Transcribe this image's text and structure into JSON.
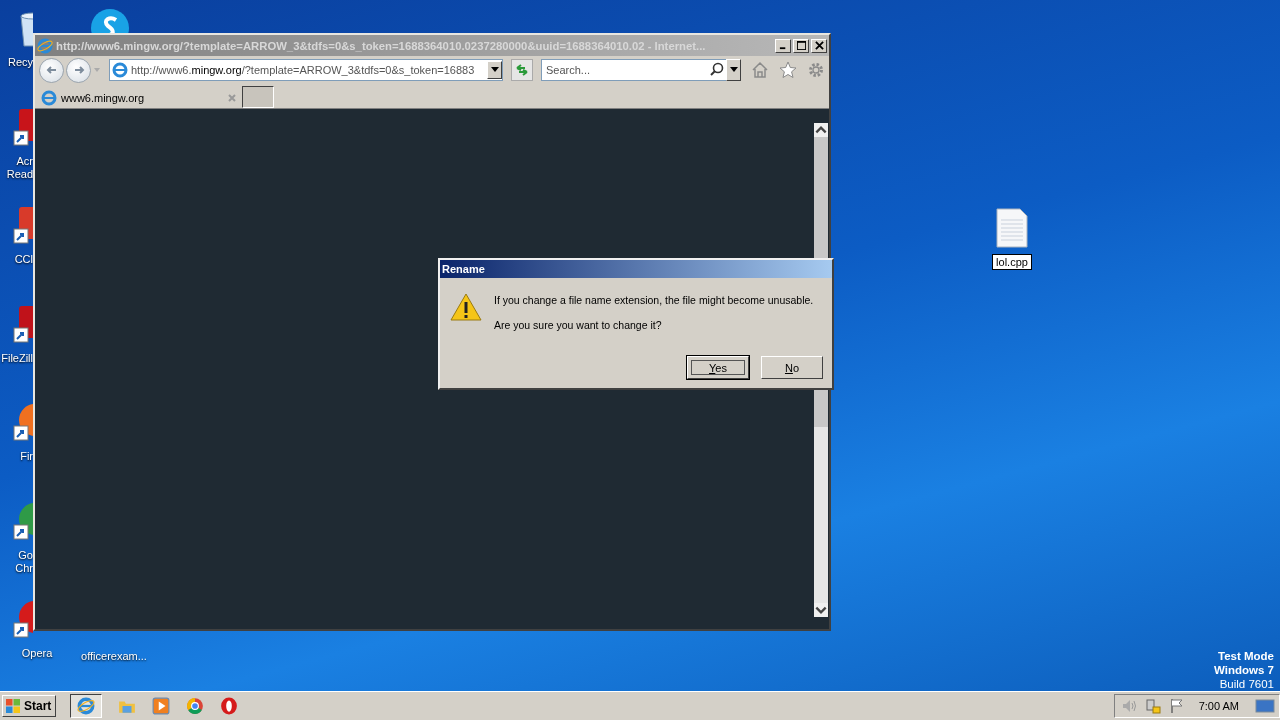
{
  "desktop_icons": [
    {
      "kind": "recycle",
      "lines": [
        "Recy"
      ]
    },
    {
      "kind": "acrobat",
      "lines": [
        "Acr",
        "Read"
      ]
    },
    {
      "kind": "ccleaner",
      "lines": [
        "CCl"
      ]
    },
    {
      "kind": "filezilla",
      "lines": [
        "FileZill"
      ]
    },
    {
      "kind": "firefox",
      "lines": [
        "Fir"
      ]
    },
    {
      "kind": "chrome",
      "lines": [
        "Go",
        "Chr"
      ]
    },
    {
      "kind": "opera",
      "lines": [
        "Opera"
      ]
    }
  ],
  "second_column": [
    {
      "kind": "skype"
    },
    {
      "kind": "document",
      "lines": [
        "officerexam..."
      ]
    }
  ],
  "browser": {
    "title": "http://www6.mingw.org/?template=ARROW_3&tdfs=0&s_token=1688364010.0237280000&uuid=1688364010.02 - Internet...",
    "address": {
      "prefix": "http://www6.",
      "domain": "mingw.org",
      "rest": "/?template=ARROW_3&tdfs=0&s_token=16883"
    },
    "search": {
      "placeholder": "Search..."
    },
    "tabs": [
      {
        "label": "www6.mingw.org",
        "selected": true
      }
    ]
  },
  "dialog": {
    "title": "Rename",
    "message": "If you change a file name extension, the file might become unusable.",
    "question": "Are you sure you want to change it?",
    "buttons": [
      {
        "label": "Yes",
        "default": true
      },
      {
        "label": "No",
        "default": false
      }
    ]
  },
  "file_icon": {
    "label": "lol.cpp",
    "editing": true
  },
  "os_notice": [
    "Test Mode",
    "Windows 7",
    "Build 7601"
  ],
  "taskbar": {
    "start": "Start",
    "apps": [
      {
        "kind": "ie",
        "active": true
      },
      {
        "kind": "explorer",
        "active": false
      },
      {
        "kind": "media",
        "active": false
      },
      {
        "kind": "chrome",
        "active": false
      },
      {
        "kind": "opera",
        "active": false
      }
    ],
    "clock": "7:00 AM"
  }
}
